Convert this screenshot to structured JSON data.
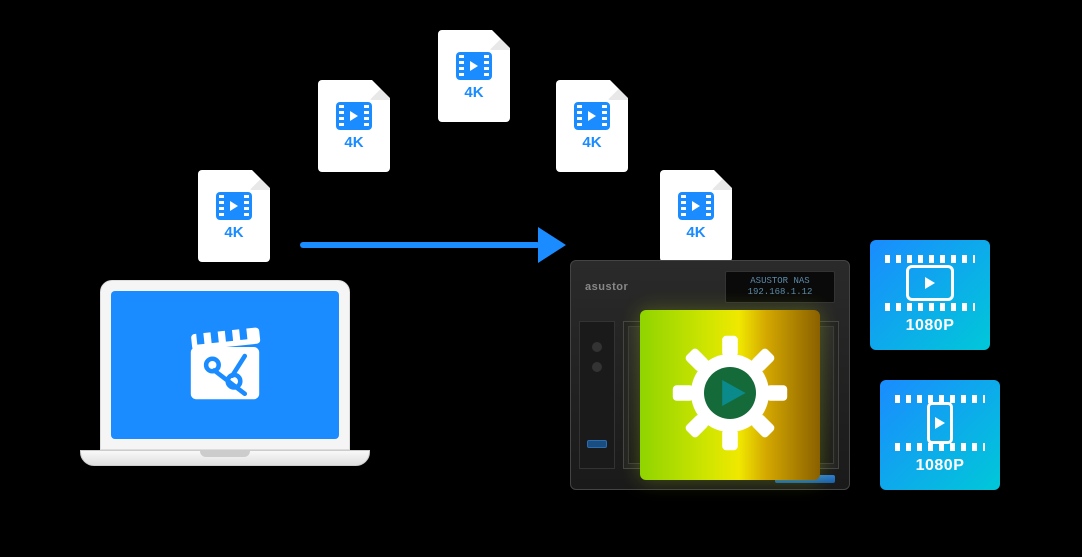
{
  "files": {
    "format_label": "4K"
  },
  "nas": {
    "brand": "asustor",
    "display_line1": "ASUSTOR NAS",
    "display_line2": "192.168.1.12"
  },
  "outputs": {
    "monitor_res": "1080P",
    "phone_res": "1080P"
  }
}
